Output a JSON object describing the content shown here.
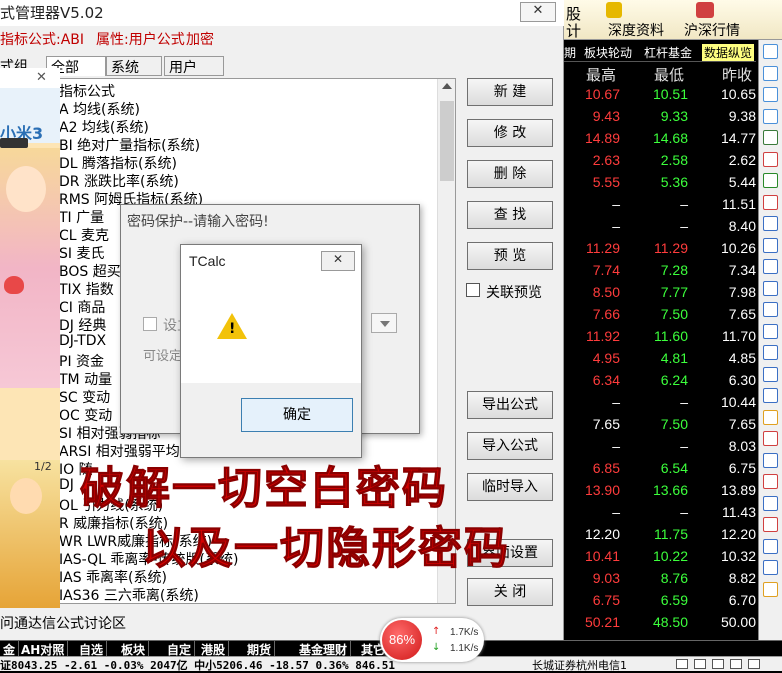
{
  "window": {
    "title": "式管理器V5.02",
    "close": "✕"
  },
  "info_bar": {
    "formula_label": "指标公式:ABI",
    "attr_label": "属性:用户公式",
    "encrypt_label": "加密"
  },
  "tabs": {
    "group": "式组",
    "all": "全部",
    "system": "系统",
    "user": "用户"
  },
  "formula_list": [
    "指标公式",
    "A  均线(系统)",
    "A2  均线(系统)",
    "BI  绝对广量指标(系统)",
    "DL  腾落指标(系统)",
    "DR  涨跌比率(系统)",
    "RMS  阿姆氏指标(系统)",
    "TI  广量",
    "CL  麦克",
    "SI  麦氏",
    "BOS  超买",
    "TIX  指数",
    "CI  商品",
    "DJ  经典",
    "DJ-TDX",
    "PI  资金",
    "TM  动量",
    "SC  变动",
    "OC  变动",
    "SI  相对强弱指标",
    "ARSI  相对强弱平均线(系统)",
    "IO  随",
    "DJ  ",
    "OL  引力线(系统)",
    "R  威廉指标(系统)",
    "WR  LWR威廉指标(系统)",
    "IAS-QL  乖离率-传统版(系统)",
    "IAS  乖离率(系统)",
    "IAS36  三六乖离(系统)"
  ],
  "buttons": [
    "新  建",
    "修  改",
    "删  除",
    "查  找",
    "预  览",
    "导出公式",
    "导入公式",
    "临时导入",
    "界面设置",
    "关  闭"
  ],
  "assoc_preview": "关联预览",
  "password_dialog": {
    "title": "密码保护--请输入密码!",
    "checkbox_label": "设立",
    "hint": "可设定"
  },
  "tcalc_dialog": {
    "title": "TCalc",
    "ok": "确定",
    "close": "✕"
  },
  "overlay": {
    "line1": "破解一切空白密码",
    "line2": "以及一切隐形密码"
  },
  "status_link": "问通达信公式讨论区",
  "right_header": {
    "tabs_top": [
      "股",
      "深度资料",
      "沪深行情"
    ],
    "tabs_top_sub": [
      "计"
    ],
    "tabs": [
      "期",
      "板块轮动",
      "杠杆基金",
      "数据纵览"
    ],
    "cols": [
      "最高",
      "最低",
      "昨收"
    ]
  },
  "quote_rows": [
    [
      "10.67",
      "10.51",
      "10.65"
    ],
    [
      "9.43",
      "9.33",
      "9.38"
    ],
    [
      "14.89",
      "14.68",
      "14.77"
    ],
    [
      "2.63",
      "2.58",
      "2.62"
    ],
    [
      "5.55",
      "5.36",
      "5.44"
    ],
    [
      "–",
      "–",
      "11.51"
    ],
    [
      "–",
      "–",
      "8.40"
    ],
    [
      "11.29",
      "11.29",
      "10.26"
    ],
    [
      "7.74",
      "7.28",
      "7.34"
    ],
    [
      "8.50",
      "7.77",
      "7.98"
    ],
    [
      "7.66",
      "7.50",
      "7.65"
    ],
    [
      "11.92",
      "11.60",
      "11.70"
    ],
    [
      "4.95",
      "4.81",
      "4.85"
    ],
    [
      "6.34",
      "6.24",
      "6.30"
    ],
    [
      "–",
      "–",
      "10.44"
    ],
    [
      "7.65",
      "7.50",
      "7.65"
    ],
    [
      "–",
      "–",
      "8.03"
    ],
    [
      "6.85",
      "6.54",
      "6.75"
    ],
    [
      "13.90",
      "13.66",
      "13.89"
    ],
    [
      "–",
      "–",
      "11.43"
    ],
    [
      "12.20",
      "11.75",
      "12.20"
    ],
    [
      "10.41",
      "10.22",
      "10.32"
    ],
    [
      "9.03",
      "8.76",
      "8.82"
    ],
    [
      "6.75",
      "6.59",
      "6.70"
    ],
    [
      "50.21",
      "48.50",
      "50.00"
    ]
  ],
  "bottom_tabs": [
    "金",
    "AH对照",
    "自选",
    "板块",
    "自定",
    "港股",
    "期货",
    "基金理财",
    "其它品种"
  ],
  "ticker": {
    "text": "证8043.25  -2.61  -0.03%  2047亿  中小5206.46  -18.57  0.36%  846.51",
    "right": "长城证券杭州电信1"
  },
  "net_widget": {
    "percent": "86%",
    "up": "1.7K/s",
    "down": "1.1K/s"
  },
  "ad": {
    "brand": "小米3",
    "page": "1/2",
    "close": "✕"
  },
  "colors": {
    "up": "#ff3c3c",
    "down": "#3cff3c",
    "flat": "#ffffff",
    "header": "#ffff80"
  }
}
